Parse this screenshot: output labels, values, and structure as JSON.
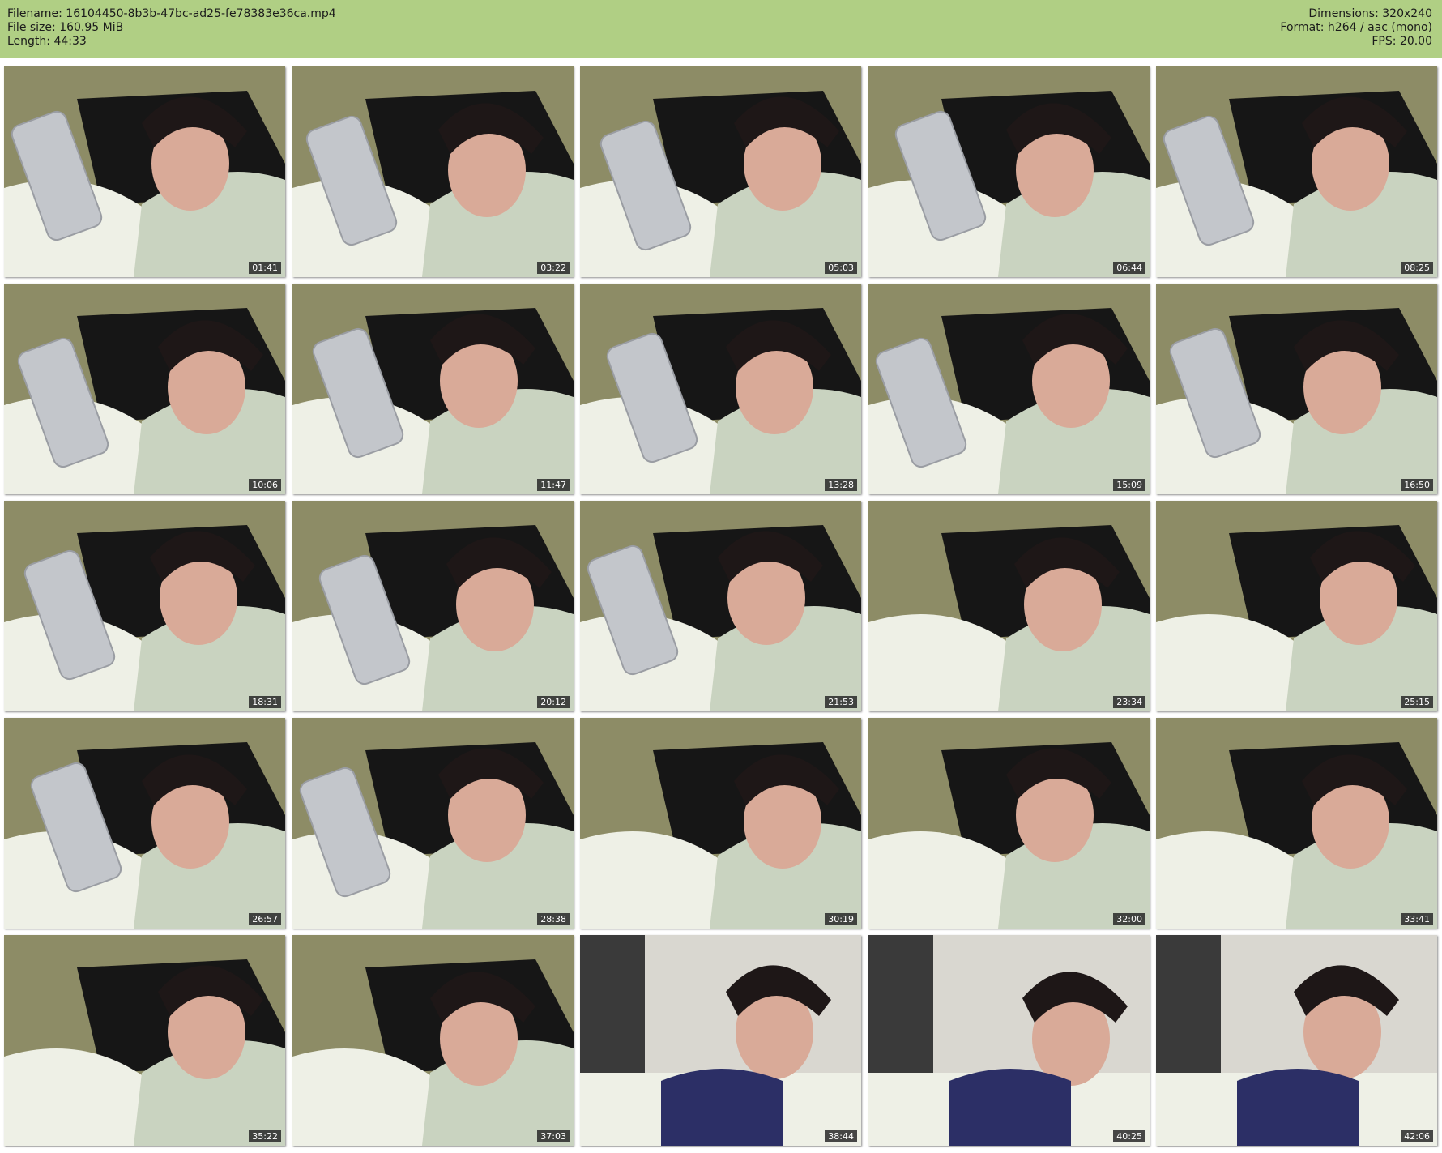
{
  "header": {
    "filename_line": "Filename: 16104450-8b3b-47bc-ad25-fe78383e36ca.mp4",
    "filesize_line": "File size: 160.95 MiB",
    "length_line": "Length: 44:33",
    "dimensions_line": "Dimensions: 320x240",
    "format_line": "Format: h264 / aac (mono)",
    "fps_line": "FPS: 20.00"
  },
  "thumbnails": [
    {
      "time": "01:41"
    },
    {
      "time": "03:22"
    },
    {
      "time": "05:03"
    },
    {
      "time": "06:44"
    },
    {
      "time": "08:25"
    },
    {
      "time": "10:06"
    },
    {
      "time": "11:47"
    },
    {
      "time": "13:28"
    },
    {
      "time": "15:09"
    },
    {
      "time": "16:50"
    },
    {
      "time": "18:31"
    },
    {
      "time": "20:12"
    },
    {
      "time": "21:53"
    },
    {
      "time": "23:34"
    },
    {
      "time": "25:15"
    },
    {
      "time": "26:57"
    },
    {
      "time": "28:38"
    },
    {
      "time": "30:19"
    },
    {
      "time": "32:00"
    },
    {
      "time": "33:41"
    },
    {
      "time": "35:22"
    },
    {
      "time": "37:03"
    },
    {
      "time": "38:44"
    },
    {
      "time": "40:25"
    },
    {
      "time": "42:06"
    }
  ],
  "colors": {
    "header_bg": "#b0cf84",
    "wall": "#8d8c66",
    "shirt": "#161616",
    "hair": "#1e1717",
    "skin": "#d9aa98",
    "duvet": "#eef0e6",
    "pillow": "#c9d3c0",
    "bra": "#2c2f66",
    "phone": "#c3c6cb"
  }
}
